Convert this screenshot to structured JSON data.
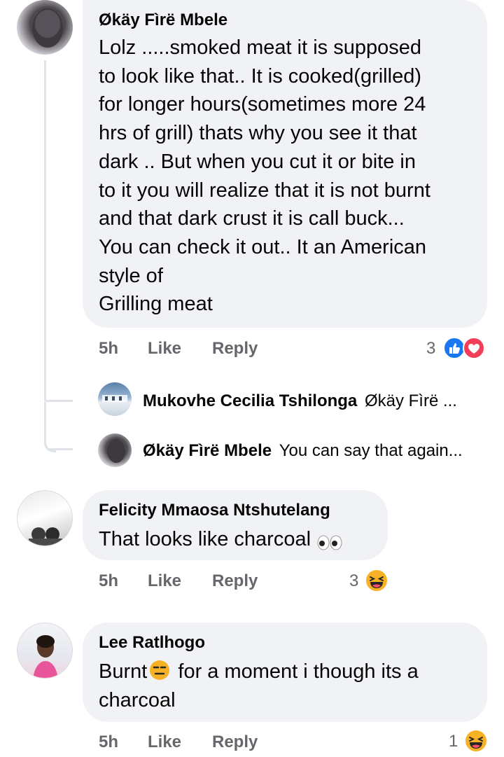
{
  "comments": [
    {
      "author": "Økäy Fìrë Mbele",
      "text": "Lolz .....smoked meat it is supposed\nto look like that.. It is cooked(grilled)\nfor longer hours(sometimes more 24\nhrs of grill) thats why you see it that\ndark ..  But when you cut it or bite in\nto it you will realize that it is not burnt\nand that dark crust it is call buck...\nYou can check it out.. It an American\nstyle of\nGrilling meat",
      "time": "5h",
      "like": "Like",
      "reply": "Reply",
      "reaction_count": "3",
      "reactions": [
        "like-icon",
        "love-icon"
      ]
    },
    {
      "author": "Felicity Mmaosa Ntshutelang",
      "text": "That looks like charcoal",
      "emoji": "eyes-icon",
      "time": "5h",
      "like": "Like",
      "reply": "Reply",
      "reaction_count": "3",
      "reactions": [
        "haha-icon"
      ]
    },
    {
      "author": "Lee Ratlhogo",
      "text_before": "Burnt",
      "emoji": "expressionless-face-icon",
      "text_after": " for a moment i though its a\ncharcoal",
      "time": "5h",
      "like": "Like",
      "reply": "Reply",
      "reaction_count": "1",
      "reactions": [
        "haha-icon"
      ]
    }
  ],
  "replies": [
    {
      "author": "Mukovhe Cecilia Tshilonga",
      "preview": "Økäy Fìrë ..."
    },
    {
      "author": "Økäy Fìrë Mbele",
      "preview": "You can say that again..."
    }
  ],
  "colors": {
    "bubble": "#f0f2f5",
    "meta": "#65676b",
    "like_blue": "#1877f2",
    "love_red": "#f33e58",
    "haha_yellow": "#f7b125"
  }
}
